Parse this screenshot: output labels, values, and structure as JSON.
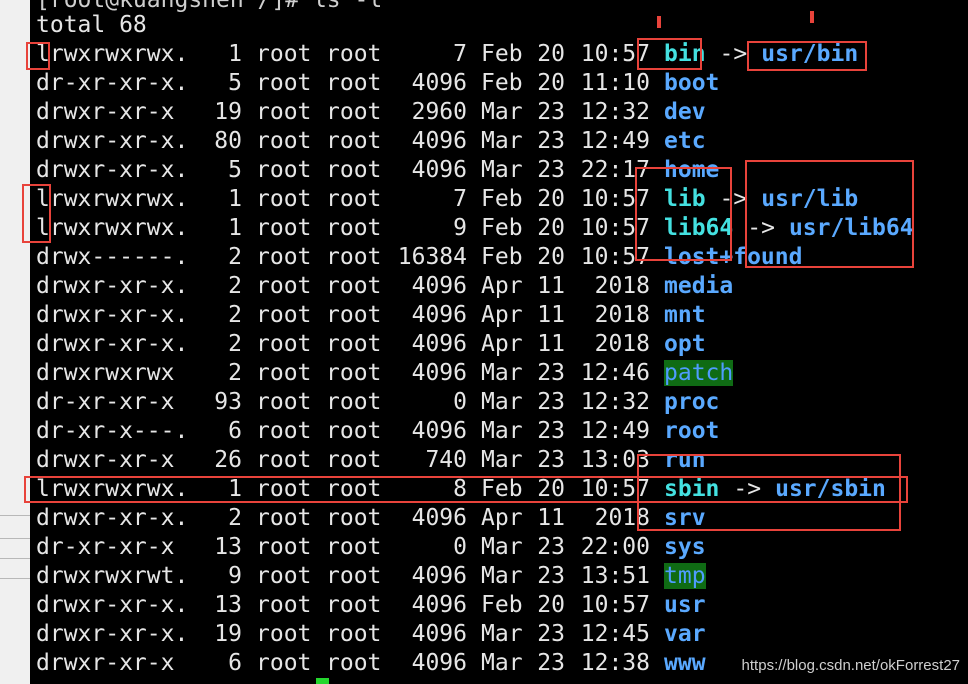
{
  "terminal": {
    "prompt_line": "[root@kuangshen /]# ls -l",
    "total": "total 68",
    "rows": [
      {
        "perm": "lrwxrwxrwx.",
        "links": "1",
        "owner": "root",
        "group": "root",
        "size": "7",
        "month": "Feb",
        "day": "20",
        "time": "10:57",
        "name": "bin",
        "kind": "symlink",
        "arrow": "->",
        "target": "usr/bin"
      },
      {
        "perm": "dr-xr-xr-x.",
        "links": "5",
        "owner": "root",
        "group": "root",
        "size": "4096",
        "month": "Feb",
        "day": "20",
        "time": "11:10",
        "name": "boot",
        "kind": "dir"
      },
      {
        "perm": "drwxr-xr-x",
        "links": "19",
        "owner": "root",
        "group": "root",
        "size": "2960",
        "month": "Mar",
        "day": "23",
        "time": "12:32",
        "name": "dev",
        "kind": "dir"
      },
      {
        "perm": "drwxr-xr-x.",
        "links": "80",
        "owner": "root",
        "group": "root",
        "size": "4096",
        "month": "Mar",
        "day": "23",
        "time": "12:49",
        "name": "etc",
        "kind": "dir"
      },
      {
        "perm": "drwxr-xr-x.",
        "links": "5",
        "owner": "root",
        "group": "root",
        "size": "4096",
        "month": "Mar",
        "day": "23",
        "time": "22:17",
        "name": "home",
        "kind": "dir"
      },
      {
        "perm": "lrwxrwxrwx.",
        "links": "1",
        "owner": "root",
        "group": "root",
        "size": "7",
        "month": "Feb",
        "day": "20",
        "time": "10:57",
        "name": "lib",
        "kind": "symlink",
        "arrow": "->",
        "target": "usr/lib"
      },
      {
        "perm": "lrwxrwxrwx.",
        "links": "1",
        "owner": "root",
        "group": "root",
        "size": "9",
        "month": "Feb",
        "day": "20",
        "time": "10:57",
        "name": "lib64",
        "kind": "symlink",
        "arrow": "->",
        "target": "usr/lib64"
      },
      {
        "perm": "drwx------.",
        "links": "2",
        "owner": "root",
        "group": "root",
        "size": "16384",
        "month": "Feb",
        "day": "20",
        "time": "10:57",
        "name": "lost+found",
        "kind": "dir"
      },
      {
        "perm": "drwxr-xr-x.",
        "links": "2",
        "owner": "root",
        "group": "root",
        "size": "4096",
        "month": "Apr",
        "day": "11",
        "time": "2018",
        "name": "media",
        "kind": "dir"
      },
      {
        "perm": "drwxr-xr-x.",
        "links": "2",
        "owner": "root",
        "group": "root",
        "size": "4096",
        "month": "Apr",
        "day": "11",
        "time": "2018",
        "name": "mnt",
        "kind": "dir"
      },
      {
        "perm": "drwxr-xr-x.",
        "links": "2",
        "owner": "root",
        "group": "root",
        "size": "4096",
        "month": "Apr",
        "day": "11",
        "time": "2018",
        "name": "opt",
        "kind": "dir"
      },
      {
        "perm": "drwxrwxrwx",
        "links": "2",
        "owner": "root",
        "group": "root",
        "size": "4096",
        "month": "Mar",
        "day": "23",
        "time": "12:46",
        "name": "patch",
        "kind": "sticky"
      },
      {
        "perm": "dr-xr-xr-x",
        "links": "93",
        "owner": "root",
        "group": "root",
        "size": "0",
        "month": "Mar",
        "day": "23",
        "time": "12:32",
        "name": "proc",
        "kind": "dir"
      },
      {
        "perm": "dr-xr-x---.",
        "links": "6",
        "owner": "root",
        "group": "root",
        "size": "4096",
        "month": "Mar",
        "day": "23",
        "time": "12:49",
        "name": "root",
        "kind": "dir"
      },
      {
        "perm": "drwxr-xr-x",
        "links": "26",
        "owner": "root",
        "group": "root",
        "size": "740",
        "month": "Mar",
        "day": "23",
        "time": "13:03",
        "name": "run",
        "kind": "dir"
      },
      {
        "perm": "lrwxrwxrwx.",
        "links": "1",
        "owner": "root",
        "group": "root",
        "size": "8",
        "month": "Feb",
        "day": "20",
        "time": "10:57",
        "name": "sbin",
        "kind": "symlink",
        "arrow": "->",
        "target": "usr/sbin"
      },
      {
        "perm": "drwxr-xr-x.",
        "links": "2",
        "owner": "root",
        "group": "root",
        "size": "4096",
        "month": "Apr",
        "day": "11",
        "time": "2018",
        "name": "srv",
        "kind": "dir"
      },
      {
        "perm": "dr-xr-xr-x",
        "links": "13",
        "owner": "root",
        "group": "root",
        "size": "0",
        "month": "Mar",
        "day": "23",
        "time": "22:00",
        "name": "sys",
        "kind": "dir"
      },
      {
        "perm": "drwxrwxrwt.",
        "links": "9",
        "owner": "root",
        "group": "root",
        "size": "4096",
        "month": "Mar",
        "day": "23",
        "time": "13:51",
        "name": "tmp",
        "kind": "sticky"
      },
      {
        "perm": "drwxr-xr-x.",
        "links": "13",
        "owner": "root",
        "group": "root",
        "size": "4096",
        "month": "Feb",
        "day": "20",
        "time": "10:57",
        "name": "usr",
        "kind": "dir"
      },
      {
        "perm": "drwxr-xr-x.",
        "links": "19",
        "owner": "root",
        "group": "root",
        "size": "4096",
        "month": "Mar",
        "day": "23",
        "time": "12:45",
        "name": "var",
        "kind": "dir"
      },
      {
        "perm": "drwxr-xr-x",
        "links": "6",
        "owner": "root",
        "group": "root",
        "size": "4096",
        "month": "Mar",
        "day": "23",
        "time": "12:38",
        "name": "www",
        "kind": "dir"
      }
    ]
  },
  "watermark": "https://blog.csdn.net/okForrest27",
  "colors": {
    "background": "#000000",
    "text": "#e6e6e6",
    "directory": "#5aa9ff",
    "symlink": "#44e1e1",
    "sticky_bg": "#0f6b14",
    "annotation": "#e8433b",
    "cursor": "#24d62e"
  }
}
